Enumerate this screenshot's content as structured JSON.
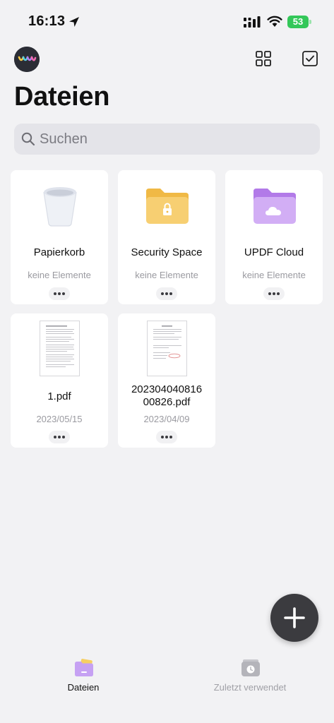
{
  "status_bar": {
    "time": "16:13",
    "battery": "53"
  },
  "header": {
    "title": "Dateien"
  },
  "search": {
    "placeholder": "Suchen"
  },
  "folders": [
    {
      "name": "Papierkorb",
      "subtitle": "keine Elemente",
      "icon": "trash-bin-icon"
    },
    {
      "name": "Security Space",
      "subtitle": "keine Elemente",
      "icon": "locked-folder-icon"
    },
    {
      "name": "UPDF Cloud",
      "subtitle": "keine Elemente",
      "icon": "cloud-folder-icon"
    }
  ],
  "files": [
    {
      "name": "1.pdf",
      "date": "2023/05/15"
    },
    {
      "name": "202304040816\n00826.pdf",
      "date": "2023/04/09"
    }
  ],
  "tab_bar": {
    "items": [
      {
        "label": "Dateien",
        "active": true
      },
      {
        "label": "Zuletzt verwendet",
        "active": false
      }
    ]
  },
  "colors": {
    "background": "#f2f2f4",
    "folder_yellow": "#f5c55c",
    "folder_purple": "#c79bf0",
    "battery_green": "#34c759",
    "tab_inactive": "#a0a0a6"
  }
}
